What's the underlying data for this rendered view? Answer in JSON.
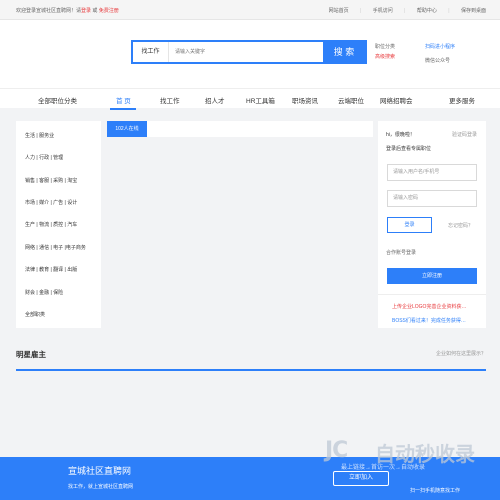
{
  "topbar": {
    "welcome": "欢迎登录宣城社区直聘网！请",
    "login": "登录",
    "or": "或",
    "register": "免费注册",
    "links": [
      "网站首页",
      "手机访问",
      "帮助中心",
      "保存到桌面"
    ]
  },
  "search": {
    "type": "找工作",
    "placeholder": "请输入关键字",
    "button": "搜 索"
  },
  "header_links": {
    "job_cat": "职位分类",
    "hr_search": "高级搜索",
    "qr_small_program": "扫码进小程序",
    "wechat_account": "微信公众号"
  },
  "nav": {
    "all_categories": "全部职位分类",
    "items": [
      "首 页",
      "找工作",
      "招人才",
      "HR工具箱",
      "职场资讯",
      "云端职位",
      "网络招聘会"
    ],
    "more": "更多服务"
  },
  "categories": [
    "生活 | 服务业",
    "人力 | 行政 | 管理",
    "销售 | 客服 | 采购 | 淘宝",
    "市场 | 媒介 | 广告 | 设计",
    "生产 | 物流 | 质控 | 汽车",
    "网络 | 通信 | 电子 |电子商务",
    "法律 | 教育 | 翻译 | 出版",
    "财会 | 金融 | 保险",
    "全部职类"
  ],
  "tabs": [
    "102人在线"
  ],
  "login_panel": {
    "hi": "hi，很晚啦！",
    "verify_login": "验证码登录",
    "hint": "登录后查看专属职位",
    "username_placeholder": "请输入用户名/手机号",
    "password_placeholder": "请输入密码",
    "login_button": "登录",
    "forgot": "忘记密码？",
    "partner": "合作账号登录",
    "register_button": "立即注册",
    "promo1": "上传企业LOGO完善企业资料获…",
    "promo2": "BOSS们看过来！完成任务获得…"
  },
  "famous_employers": {
    "title": "明星雇主",
    "question": "企业如何在这里展示？"
  },
  "footer": {
    "title": "宣城社区直聘网",
    "subtitle": "找工作，就上宣城社区直聘网",
    "button": "立即加入",
    "scan": "扫一扫手机随意找工作"
  },
  "watermark": {
    "logo": "JC",
    "text": "自动秒收录",
    "sub": "最上链接→首访一次→自动收录"
  },
  "colors": {
    "accent": "#2d7ff9",
    "red": "#e8393c"
  }
}
